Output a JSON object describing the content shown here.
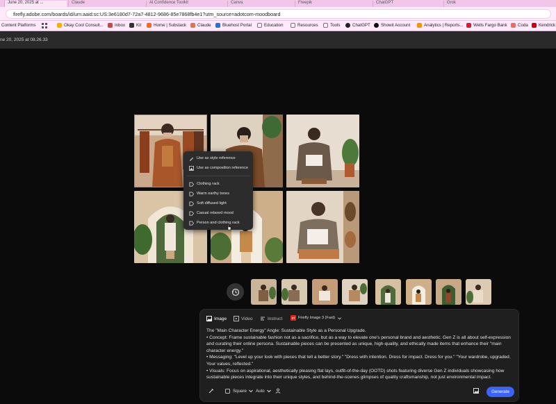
{
  "browser": {
    "tabs": [
      {
        "label": "June 20, 2025 at ..."
      },
      {
        "label": "Claude"
      },
      {
        "label": "Al Confidence Toolkit"
      },
      {
        "label": "Canva"
      },
      {
        "label": "Freepik"
      },
      {
        "label": "ChatGPT"
      },
      {
        "label": "Grok"
      }
    ],
    "url": "firefly.adobe.com/boards/id/urn:aaid:sc:US:3e6180d7-72a7-4812-9686-85e7868fb4e1?utm_source=adotcom-moodboard",
    "bookmarks": [
      {
        "label": "Content Platforms",
        "color": "#8a8a8a"
      },
      {
        "label": "Okay Cool Consult...",
        "color": "#f0b400"
      },
      {
        "label": "Inbox",
        "color": "#d44638"
      },
      {
        "label": "Kit",
        "color": "#333333"
      },
      {
        "label": "Home | Substack",
        "color": "#ff6719"
      },
      {
        "label": "Claude",
        "color": "#d97757"
      },
      {
        "label": "Bluehost Portal",
        "color": "#2f6fd1"
      },
      {
        "label": "Education",
        "color": "#999999"
      },
      {
        "label": "Resources",
        "color": "#999999"
      },
      {
        "label": "Tools",
        "color": "#999999"
      },
      {
        "label": "ChatGPT",
        "color": "#222222"
      },
      {
        "label": "Showit Account",
        "color": "#111111"
      },
      {
        "label": "Analytics | Reports...",
        "color": "#f29900"
      },
      {
        "label": "Wells Fargo Bank",
        "color": "#d71e28"
      },
      {
        "label": "Coda",
        "color": "#f46a54"
      },
      {
        "label": "Kendrick",
        "color": "#cc0000"
      }
    ]
  },
  "app": {
    "timestamp": "ne 20, 2025 at 08.26.33"
  },
  "context_menu": {
    "items": [
      {
        "label": "Use as style reference",
        "icon": "brush-icon"
      },
      {
        "label": "Use as composition reference",
        "icon": "composition-icon"
      },
      {
        "label": "Clothing rack",
        "icon": "tag-icon"
      },
      {
        "label": "Warm earthy tones",
        "icon": "tag-icon"
      },
      {
        "label": "Soft diffused light",
        "icon": "tag-icon"
      },
      {
        "label": "Casual relaxed mood",
        "icon": "tag-icon"
      },
      {
        "label": "Person and clothing rack",
        "icon": "tag-icon"
      }
    ]
  },
  "prompt_panel": {
    "tabs": [
      {
        "label": "Image",
        "icon": "image-icon"
      },
      {
        "label": "Video",
        "icon": "video-icon"
      },
      {
        "label": "Instruct",
        "icon": "instruct-icon"
      }
    ],
    "model": "Firefly Image 3 (Fast)",
    "model_badge": "Ff",
    "prompt_lines": [
      "The \"Main Character Energy\" Angle: Sustainable Style as a Personal Upgrade.",
      "•      Concept: Frame sustainable fashion not as a sacrifice, but as a way to elevate one's personal brand and aesthetic. Gen Z is all about self-expression and curating their online persona. Sustainable pieces can be presented as unique, high-quality, and ethically made items that enhance their \"main character energy.\"",
      "•      Messaging: \"Level up your look with pieces that tell a better story.\" \"Dress with intention. Dress for impact. Dress for you.\" \"Your wardrobe, upgraded. Your values, reflected.\"",
      "•      Visuals: Focus on aspirational, aesthetically pleasing flat lays, outfit-of-the-day (OOTD) shots featuring diverse Gen Z individuals showcasing how sustainable pieces integrate into their unique styles, and behind-the-scenes glimpses of quality craftsmanship, not just environmental impact."
    ],
    "aspect_label": "Square",
    "auto_label": "Auto",
    "generate_label": "Generate"
  },
  "colors": {
    "accent": "#3b63fb",
    "selection": "#7a8cff",
    "panel": "#1f1f1f"
  }
}
